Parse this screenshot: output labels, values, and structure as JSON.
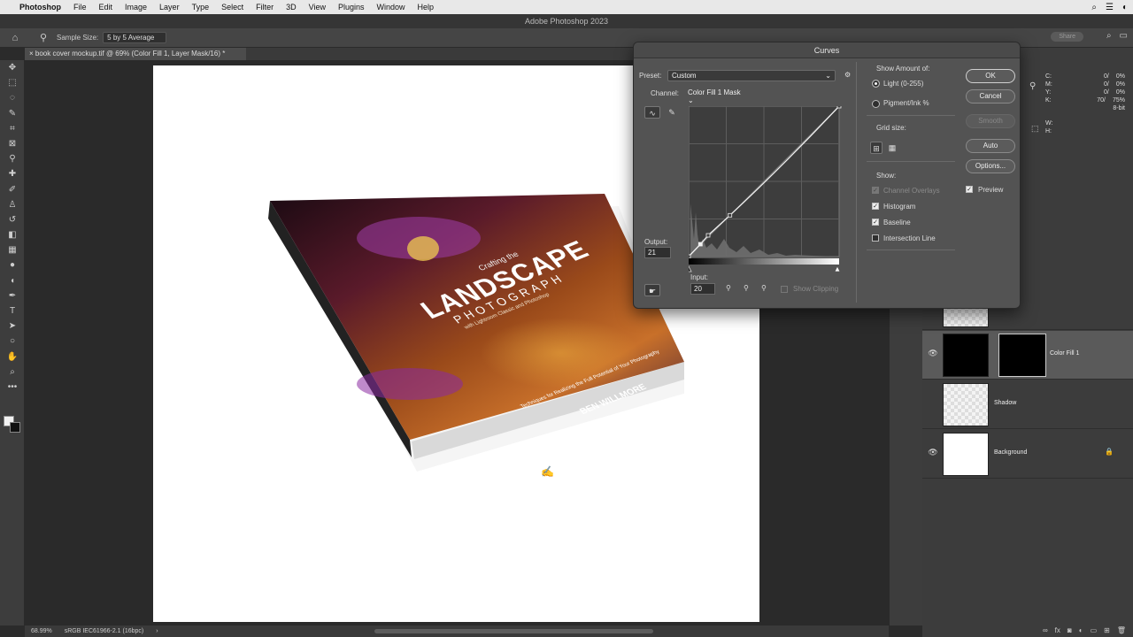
{
  "menubar": {
    "app": "Photoshop",
    "items": [
      "File",
      "Edit",
      "Image",
      "Layer",
      "Type",
      "Select",
      "Filter",
      "3D",
      "View",
      "Plugins",
      "Window",
      "Help"
    ]
  },
  "titlebar": {
    "title": "Adobe Photoshop 2023"
  },
  "optionsbar": {
    "sample_size_label": "Sample Size:",
    "sample_size_value": "5 by 5 Average",
    "share_label": "Share"
  },
  "document_tab": {
    "label": "book cover mockup.tif @ 69% (Color Fill 1, Layer Mask/16) *"
  },
  "book": {
    "pretitle": "Crafting the",
    "title": "LANDSCAPE",
    "subtitle": "PHOTOGRAPH",
    "line": "with Lightroom Classic and Photoshop",
    "tagline": "Techniques for Realizing the Full Potential of Your Photography",
    "author": "BEN WILLMORE"
  },
  "info_panel": {
    "c_label": "C:",
    "c_vals": "0/",
    "c_vals2": "0%",
    "m_label": "M:",
    "m_vals": "0/",
    "m_vals2": "0%",
    "y_label": "Y:",
    "y_vals": "0/",
    "y_vals2": "0%",
    "k_label": "K:",
    "k_vals": "70/",
    "k_vals2": "75%",
    "bit": "8-bit",
    "w_label": "W:",
    "h_label": "H:"
  },
  "layers": [
    {
      "name": "Color Fill 1",
      "visible": true,
      "active": true
    },
    {
      "name": "Shadow",
      "visible": false,
      "active": false
    },
    {
      "name": "Background",
      "visible": true,
      "active": false,
      "locked": true
    }
  ],
  "statusbar": {
    "zoom": "68.99%",
    "profile": "sRGB IEC61966-2.1 (16bpc)"
  },
  "curves": {
    "title": "Curves",
    "preset_label": "Preset:",
    "preset_value": "Custom",
    "channel_label": "Channel:",
    "channel_value": "Color Fill 1 Mask",
    "output_label": "Output:",
    "output_value": "21",
    "input_label": "Input:",
    "input_value": "20",
    "show_clipping_label": "Show Clipping",
    "show_amount_label": "Show Amount of:",
    "light_label": "Light  (0-255)",
    "pigment_label": "Pigment/Ink %",
    "grid_size_label": "Grid size:",
    "show_label": "Show:",
    "channel_overlays_label": "Channel Overlays",
    "histogram_label": "Histogram",
    "baseline_label": "Baseline",
    "intersection_label": "Intersection Line",
    "ok_label": "OK",
    "cancel_label": "Cancel",
    "smooth_label": "Smooth",
    "auto_label": "Auto",
    "options_label": "Options...",
    "preview_label": "Preview",
    "curve_points": [
      [
        0,
        0
      ],
      [
        20,
        21
      ],
      [
        33,
        36
      ],
      [
        70,
        70
      ],
      [
        255,
        255
      ]
    ]
  }
}
